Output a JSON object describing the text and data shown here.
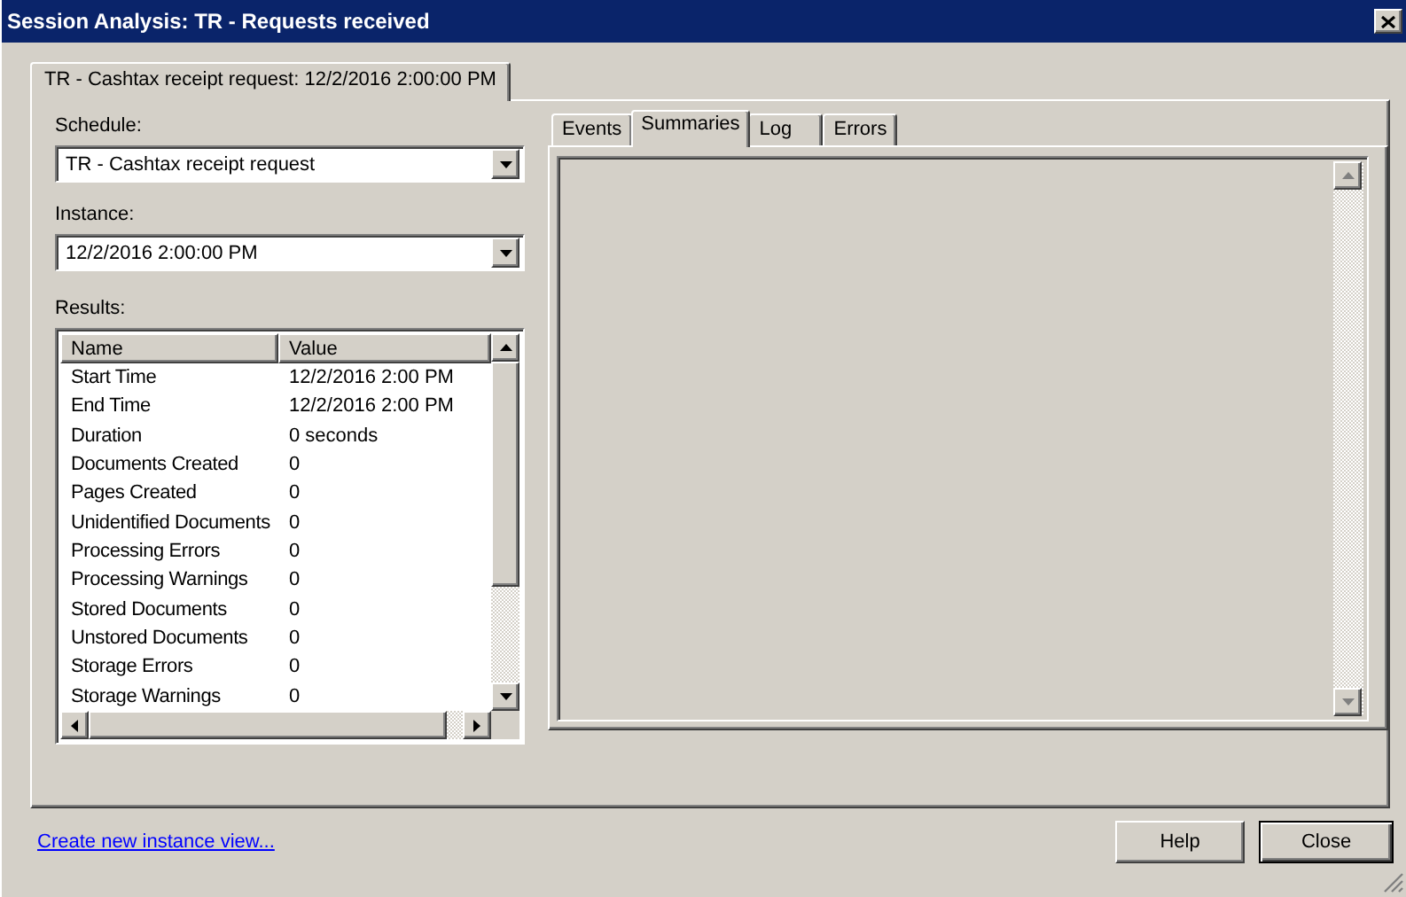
{
  "window": {
    "title": "Session Analysis: TR - Requests received"
  },
  "outer_tabs": [
    {
      "label": "TR - Cashtax receipt request: 12/2/2016 2:00:00 PM",
      "selected": true
    }
  ],
  "schedule": {
    "label": "Schedule:",
    "value": "TR - Cashtax receipt request"
  },
  "instance": {
    "label": "Instance:",
    "value": "12/2/2016 2:00:00 PM"
  },
  "results": {
    "label": "Results:",
    "columns": [
      "Name",
      "Value"
    ],
    "rows": [
      [
        "Start Time",
        "12/2/2016 2:00 PM"
      ],
      [
        "End Time",
        "12/2/2016 2:00 PM"
      ],
      [
        "Duration",
        "0 seconds"
      ],
      [
        "Documents Created",
        "0"
      ],
      [
        "Pages Created",
        "0"
      ],
      [
        "Unidentified Documents",
        "0"
      ],
      [
        "Processing Errors",
        "0"
      ],
      [
        "Processing Warnings",
        "0"
      ],
      [
        "Stored Documents",
        "0"
      ],
      [
        "Unstored Documents",
        "0"
      ],
      [
        "Storage Errors",
        "0"
      ],
      [
        "Storage Warnings",
        "0"
      ]
    ]
  },
  "inner_tabs": [
    {
      "label": "Events",
      "selected": false
    },
    {
      "label": "Summaries",
      "selected": true
    },
    {
      "label": "Log",
      "selected": false
    },
    {
      "label": "Errors",
      "selected": false
    }
  ],
  "link": "Create new instance view...",
  "buttons": [
    {
      "label": "Help",
      "default": false
    },
    {
      "label": "Close",
      "default": true
    }
  ]
}
